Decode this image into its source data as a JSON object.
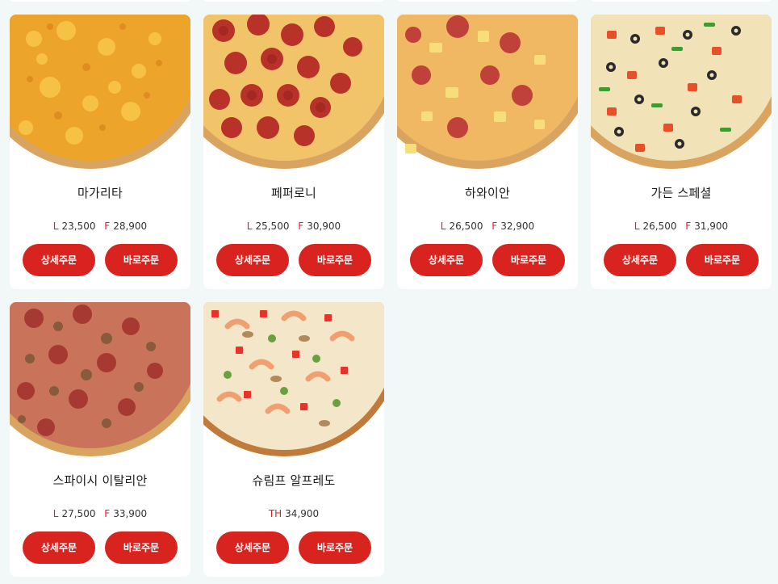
{
  "colors": {
    "accent": "#d8231f",
    "page_background": "#f2f7f7",
    "card_background": "#ffffff"
  },
  "menu": {
    "items": [
      {
        "name": "마가리타",
        "prices": [
          {
            "size": "L",
            "price": "23,500"
          },
          {
            "size": "F",
            "price": "28,900"
          }
        ],
        "detail_label": "상세주문",
        "quick_label": "바로주문"
      },
      {
        "name": "페퍼로니",
        "prices": [
          {
            "size": "L",
            "price": "25,500"
          },
          {
            "size": "F",
            "price": "30,900"
          }
        ],
        "detail_label": "상세주문",
        "quick_label": "바로주문"
      },
      {
        "name": "하와이안",
        "prices": [
          {
            "size": "L",
            "price": "26,500"
          },
          {
            "size": "F",
            "price": "32,900"
          }
        ],
        "detail_label": "상세주문",
        "quick_label": "바로주문"
      },
      {
        "name": "가든 스페셜",
        "prices": [
          {
            "size": "L",
            "price": "26,500"
          },
          {
            "size": "F",
            "price": "31,900"
          }
        ],
        "detail_label": "상세주문",
        "quick_label": "바로주문"
      },
      {
        "name": "스파이시 이탈리안",
        "prices": [
          {
            "size": "L",
            "price": "27,500"
          },
          {
            "size": "F",
            "price": "33,900"
          }
        ],
        "detail_label": "상세주문",
        "quick_label": "바로주문"
      },
      {
        "name": "슈림프 알프레도",
        "prices": [
          {
            "size": "TH",
            "price": "34,900"
          }
        ],
        "detail_label": "상세주문",
        "quick_label": "바로주문"
      }
    ]
  }
}
